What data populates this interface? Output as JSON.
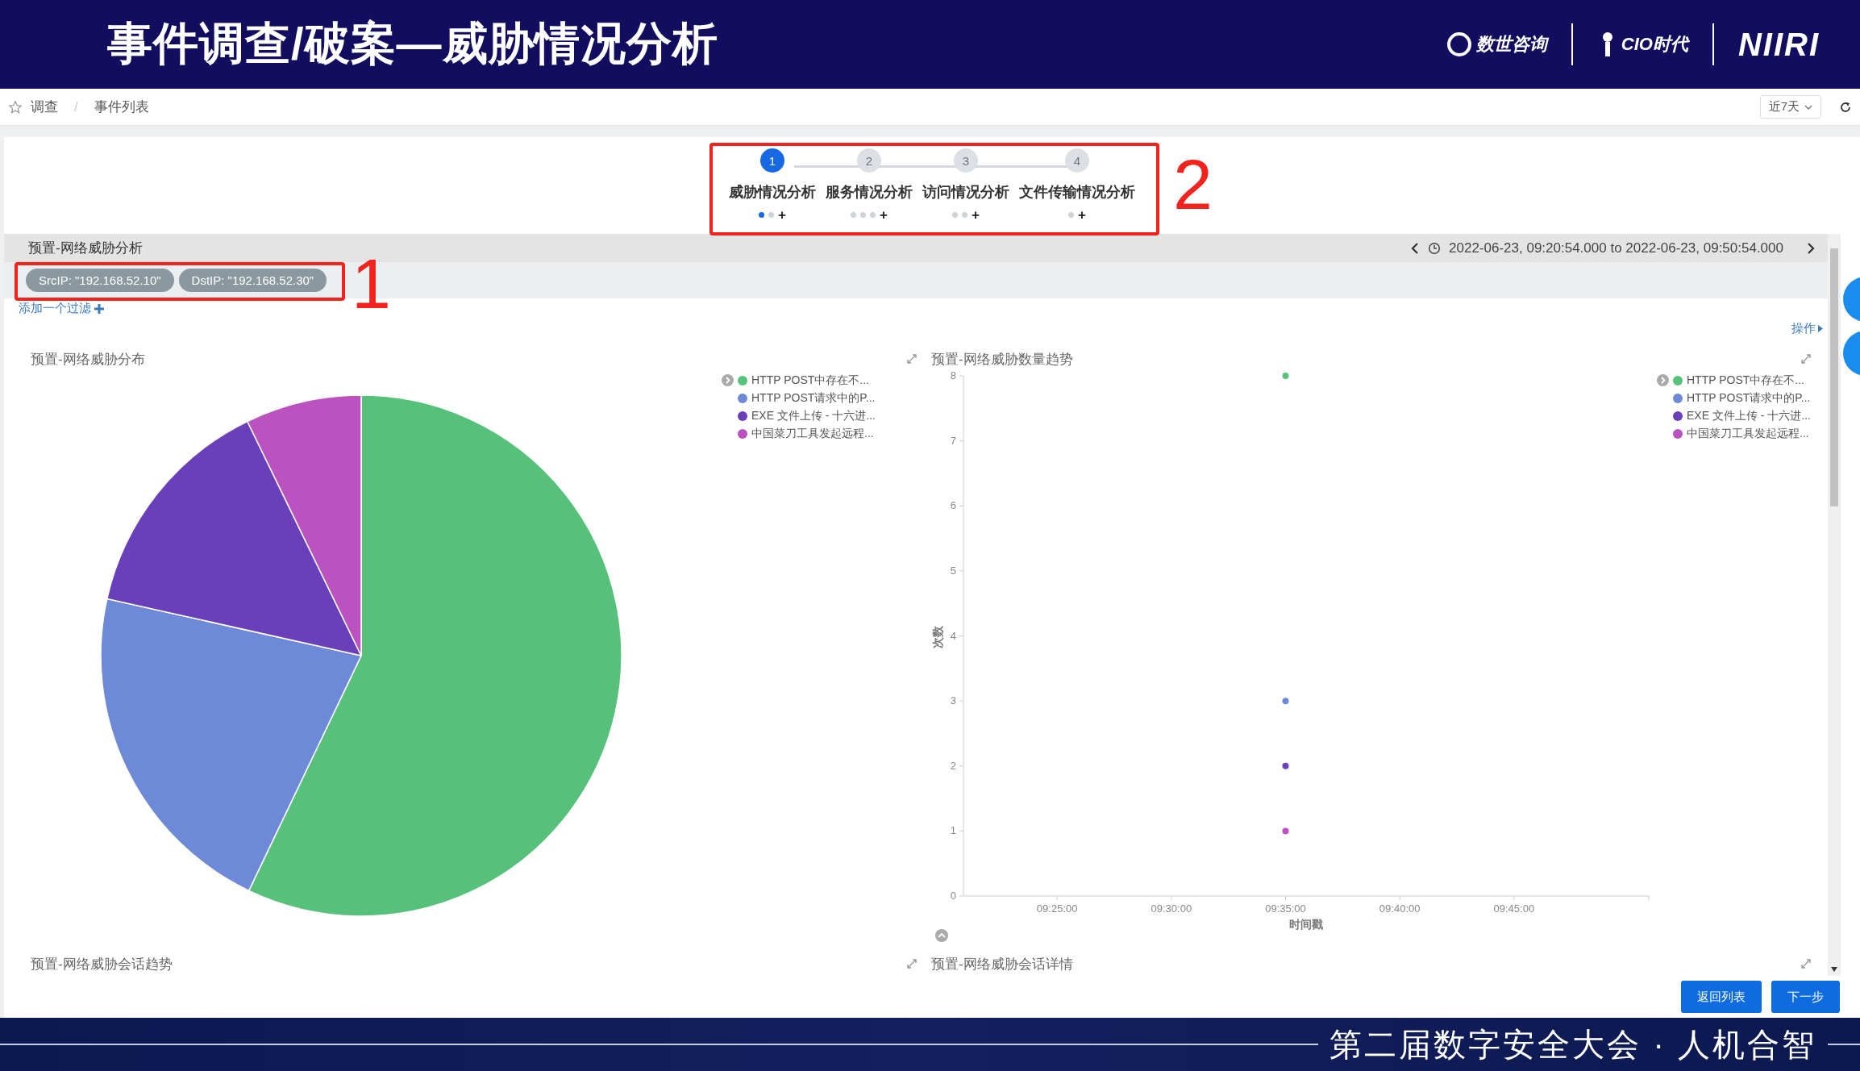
{
  "header": {
    "title": "事件调查/破案—威胁情况分析",
    "logos": [
      "数世咨询",
      "CIO时代",
      "NIIRI"
    ]
  },
  "breadcrumb": {
    "items": [
      "调查",
      "/",
      "事件列表"
    ],
    "range": "近7天"
  },
  "steps": [
    {
      "number": "1",
      "label": "威胁情况分析",
      "selected": true,
      "pages": [
        {
          "selected": true
        },
        {
          "selected": false
        }
      ],
      "add": "+"
    },
    {
      "number": "2",
      "label": "服务情况分析",
      "selected": false,
      "pages": [
        {
          "selected": false
        },
        {
          "selected": false
        },
        {
          "selected": false
        }
      ],
      "add": "+"
    },
    {
      "number": "3",
      "label": "访问情况分析",
      "selected": false,
      "pages": [
        {
          "selected": false
        },
        {
          "selected": false
        }
      ],
      "add": "+"
    },
    {
      "number": "4",
      "label": "文件传输情况分析",
      "selected": false,
      "pages": [
        {
          "selected": false
        }
      ],
      "add": "+"
    }
  ],
  "section": {
    "title": "预置-网络威胁分析",
    "time_range": "2022-06-23, 09:20:54.000 to 2022-06-23, 09:50:54.000"
  },
  "filters": [
    "SrcIP: \"192.168.52.10\"",
    "DstIP: \"192.168.52.30\""
  ],
  "add_filter": "添加一个过滤",
  "actions": "操作",
  "distribution": {
    "title": "预置-网络威胁分布",
    "legend": [
      {
        "label": "HTTP POST中存在不...",
        "color": "#57c17b"
      },
      {
        "label": "HTTP POST请求中的P...",
        "color": "#6f89d9"
      },
      {
        "label": "EXE 文件上传 - 十六进...",
        "color": "#6a3fba"
      },
      {
        "label": "中国菜刀工具发起远程...",
        "color": "#bb52c0"
      }
    ],
    "chart_data": {
      "type": "pie",
      "values": [
        57.1,
        21.4,
        14.3,
        7.2
      ]
    }
  },
  "trend": {
    "title": "预置-网络威胁数量趋势",
    "chart_data": {
      "type": "scatter",
      "xlabel": "时间戳",
      "ylabel": "次数",
      "ylim": [
        0,
        8
      ],
      "categories": [
        "09:25:00",
        "09:30:00",
        "09:35:00",
        "09:40:00",
        "09:45:00"
      ],
      "yticks": [
        0,
        1,
        2,
        3,
        4,
        5,
        6,
        7,
        8
      ],
      "series": [
        {
          "name": "HTTP POST中存在不...",
          "color": "#57c17b",
          "values": [
            null,
            null,
            8,
            null,
            null
          ]
        },
        {
          "name": "HTTP POST请求中的P...",
          "color": "#6f89d9",
          "values": [
            null,
            null,
            3,
            null,
            null
          ]
        },
        {
          "name": "EXE 文件上传 - 十六进...",
          "color": "#6a3fba",
          "values": [
            null,
            null,
            2,
            null,
            null
          ]
        },
        {
          "name": "中国菜刀工具发起远程...",
          "color": "#bb52c0",
          "values": [
            null,
            null,
            1,
            null,
            null
          ]
        }
      ]
    }
  },
  "bottom_panels": [
    "预置-网络威胁会话趋势",
    "预置-网络威胁会话详情"
  ],
  "buttons": [
    "返回列表",
    "下一步"
  ],
  "annotations": [
    {
      "label": "1"
    },
    {
      "label": "2"
    }
  ],
  "footer": {
    "text": "第二届数字安全大会 · 人机合智"
  }
}
